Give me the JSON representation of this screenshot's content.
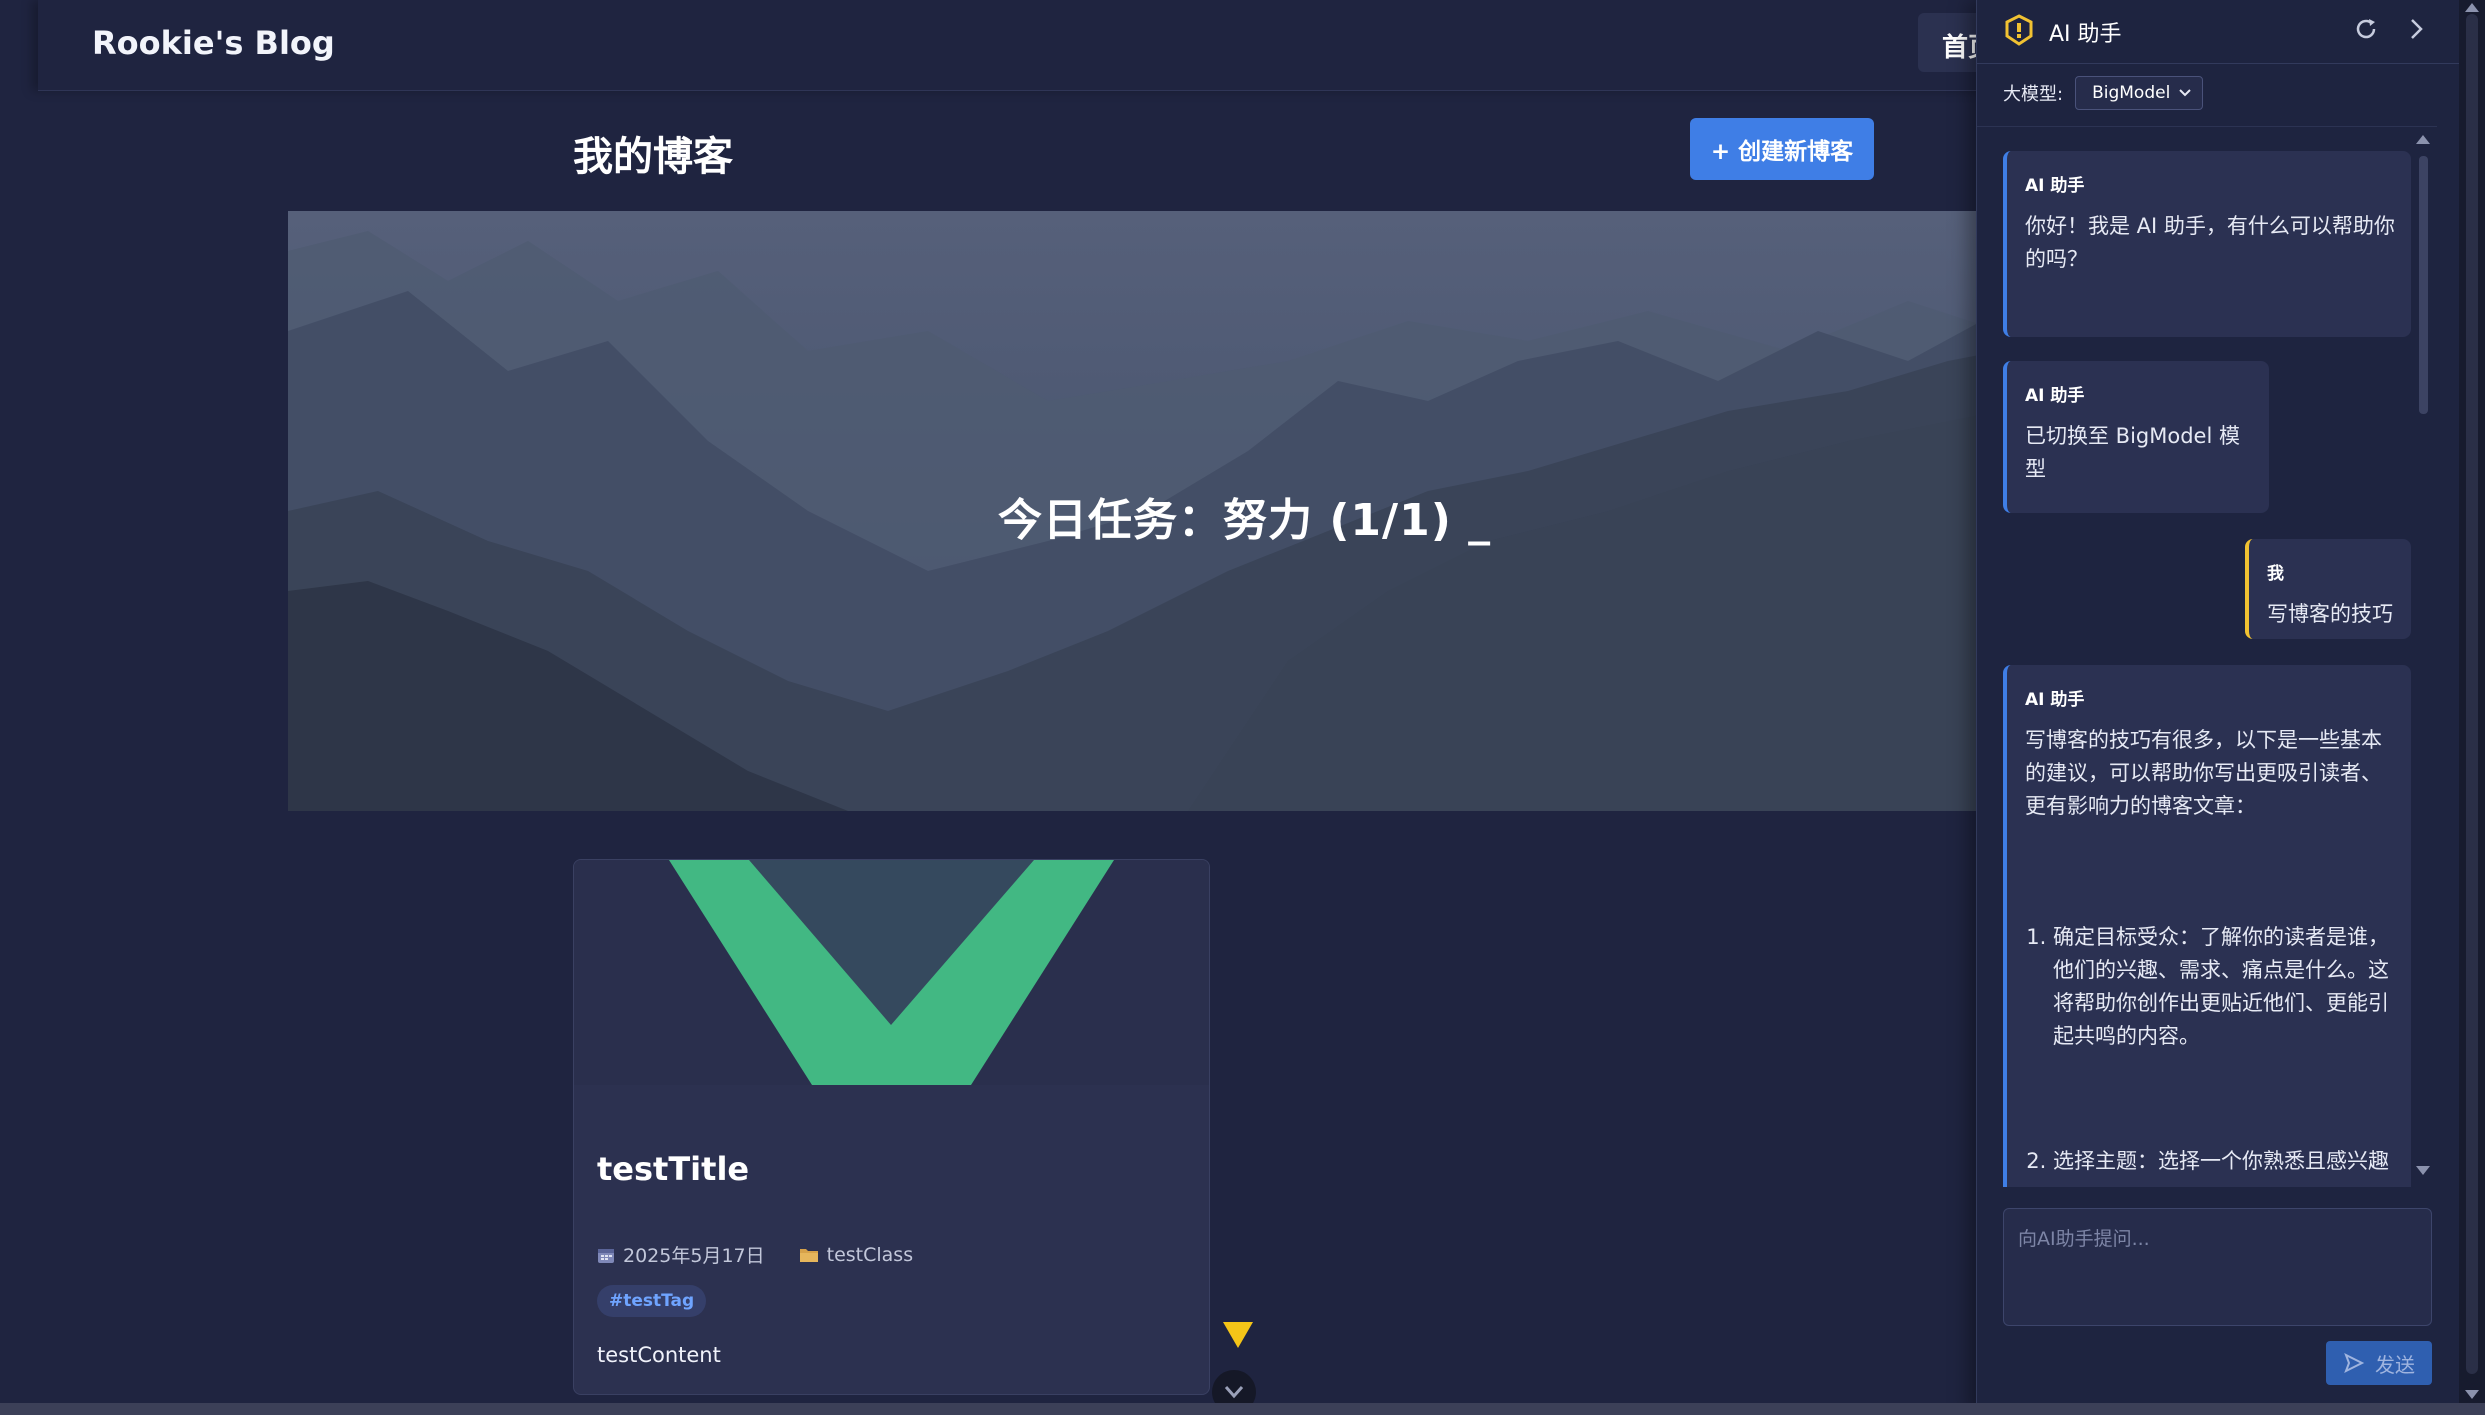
{
  "blog": {
    "brand": "Rookie's Blog",
    "nav_home": "首页",
    "page_title": "我的博客",
    "create_button": "+ 创建新博客",
    "hero_text": "今日任务：努力 (1/1) _",
    "post": {
      "title": "testTitle",
      "date": "2025年5月17日",
      "category": "testClass",
      "tag": "#testTag",
      "content": "testContent"
    }
  },
  "ai": {
    "title": "AI 助手",
    "model_label": "大模型:",
    "model_value": "BigModel",
    "input_placeholder": "向AI助手提问...",
    "send_label": "发送",
    "messages": [
      {
        "sender": "AI 助手",
        "text": "你好！我是 AI 助手，有什么可以帮助你的吗？"
      },
      {
        "sender": "AI 助手",
        "text": "已切换至 BigModel 模型"
      },
      {
        "sender": "我",
        "text": "写博客的技巧"
      },
      {
        "sender": "AI 助手",
        "text": "写博客的技巧有很多，以下是一些基本的建议，可以帮助你写出更吸引读者、更有影响力的博客文章：",
        "items": [
          "确定目标受众：了解你的读者是谁，他们的兴趣、需求、痛点是什么。这将帮助你创作出更贴近他们、更能引起共鸣的内容。",
          "选择主题：选择一个你熟悉且感兴趣"
        ]
      }
    ]
  },
  "colors": {
    "accent": "#3f7ee6",
    "user_accent": "#f1c232",
    "vue_green": "#42b883",
    "vue_dark": "#35495e"
  }
}
